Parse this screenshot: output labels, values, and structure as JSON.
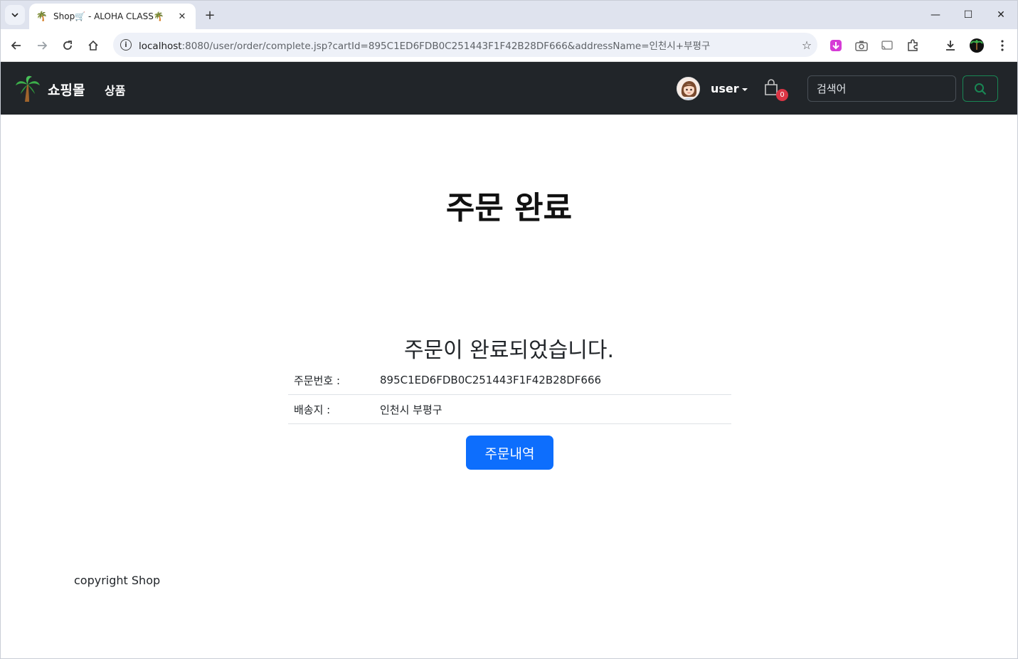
{
  "browser": {
    "tab_title": "Shop🛒 - ALOHA CLASS🌴",
    "url_host": "localhost",
    "url_rest": ":8080/user/order/complete.jsp?cartId=895C1ED6FDB0C251443F1F42B28DF666&addressName=인천시+부평구"
  },
  "navbar": {
    "brand": "쇼핑몰",
    "products_link": "상품",
    "user_label": "user",
    "cart_count": "0",
    "search_placeholder": "검색어"
  },
  "main": {
    "title": "주문 완료",
    "message": "주문이 완료되었습니다.",
    "rows": [
      {
        "label": "주문번호 :",
        "value": "895C1ED6FDB0C251443F1F42B28DF666"
      },
      {
        "label": "배송지 :",
        "value": "인천시 부평구"
      }
    ],
    "order_history_button": "주문내역"
  },
  "footer": {
    "text": "copyright Shop"
  },
  "colors": {
    "navbar_bg": "#212529",
    "primary": "#0d6efd",
    "search_btn_border": "#198754",
    "badge": "#dc3545"
  }
}
